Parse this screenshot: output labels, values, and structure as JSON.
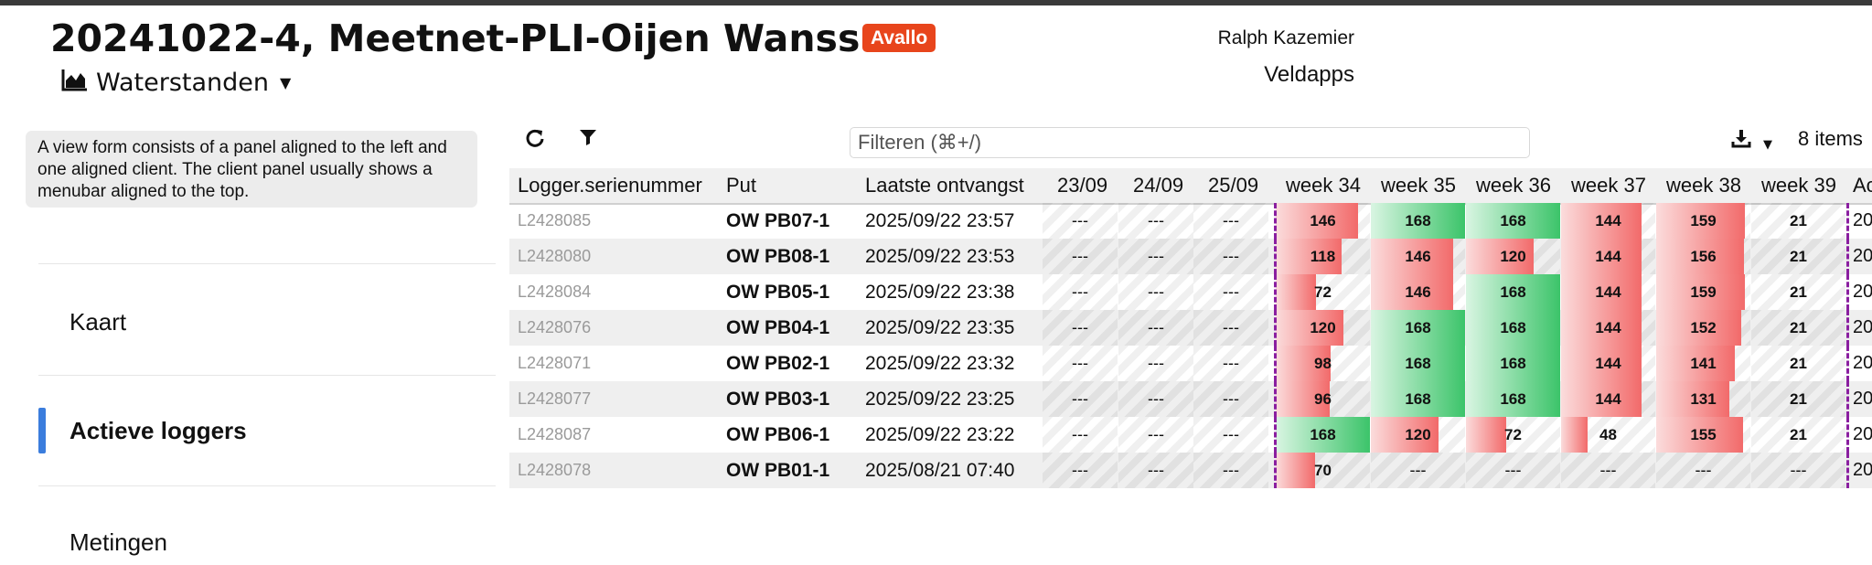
{
  "header": {
    "title": "20241022-4, Meetnet-PLI-Oijen Wanssum",
    "badge": "Avallo",
    "view_label": "Waterstanden",
    "user_name": "Ralph Kazemier",
    "app_name": "Veldapps"
  },
  "sidebar": {
    "info_text": "A view form consists of a panel aligned to the left and one aligned client. The client panel usually shows a menubar aligned to the top.",
    "items": [
      {
        "label": "Kaart",
        "active": false
      },
      {
        "label": "Actieve loggers",
        "active": true
      },
      {
        "label": "Metingen",
        "active": false
      }
    ]
  },
  "toolbar": {
    "filter_placeholder": "Filteren (⌘+/)",
    "items_count": "8 items"
  },
  "table": {
    "columns": [
      "Logger.serienummer",
      "Put",
      "Laatste ontvangst",
      "23/09",
      "24/09",
      "25/09",
      "week 34",
      "week 35",
      "week 36",
      "week 37",
      "week 38",
      "week 39",
      "Ac"
    ],
    "empty_value": "---",
    "max_per_week": 168,
    "rows": [
      {
        "serial": "L2428085",
        "put": "OW PB07-1",
        "last": "2025/09/22 23:57",
        "d1": "---",
        "d2": "---",
        "d3": "---",
        "w34": "146",
        "w35": "168",
        "w36": "168",
        "w37": "144",
        "w38": "159",
        "w39": "21",
        "extra": "20"
      },
      {
        "serial": "L2428080",
        "put": "OW PB08-1",
        "last": "2025/09/22 23:53",
        "d1": "---",
        "d2": "---",
        "d3": "---",
        "w34": "118",
        "w35": "146",
        "w36": "120",
        "w37": "144",
        "w38": "156",
        "w39": "21",
        "extra": "20"
      },
      {
        "serial": "L2428084",
        "put": "OW PB05-1",
        "last": "2025/09/22 23:38",
        "d1": "---",
        "d2": "---",
        "d3": "---",
        "w34": "72",
        "w35": "146",
        "w36": "168",
        "w37": "144",
        "w38": "159",
        "w39": "21",
        "extra": "20"
      },
      {
        "serial": "L2428076",
        "put": "OW PB04-1",
        "last": "2025/09/22 23:35",
        "d1": "---",
        "d2": "---",
        "d3": "---",
        "w34": "120",
        "w35": "168",
        "w36": "168",
        "w37": "144",
        "w38": "152",
        "w39": "21",
        "extra": "20"
      },
      {
        "serial": "L2428071",
        "put": "OW PB02-1",
        "last": "2025/09/22 23:32",
        "d1": "---",
        "d2": "---",
        "d3": "---",
        "w34": "98",
        "w35": "168",
        "w36": "168",
        "w37": "144",
        "w38": "141",
        "w39": "21",
        "extra": "20"
      },
      {
        "serial": "L2428077",
        "put": "OW PB03-1",
        "last": "2025/09/22 23:25",
        "d1": "---",
        "d2": "---",
        "d3": "---",
        "w34": "96",
        "w35": "168",
        "w36": "168",
        "w37": "144",
        "w38": "131",
        "w39": "21",
        "extra": "20"
      },
      {
        "serial": "L2428087",
        "put": "OW PB06-1",
        "last": "2025/09/22 23:22",
        "d1": "---",
        "d2": "---",
        "d3": "---",
        "w34": "168",
        "w35": "120",
        "w36": "72",
        "w37": "48",
        "w38": "155",
        "w39": "21",
        "extra": "20"
      },
      {
        "serial": "L2428078",
        "put": "OW PB01-1",
        "last": "2025/08/21 07:40",
        "d1": "---",
        "d2": "---",
        "d3": "---",
        "w34": "70",
        "w35": "---",
        "w36": "---",
        "w37": "---",
        "w38": "---",
        "w39": "---",
        "extra": "20"
      }
    ]
  },
  "colors": {
    "badge": "#e8451c",
    "active_bar": "#3b7ddd",
    "full_green": "#3cc46a",
    "partial_red": "#f26a6a",
    "marker": "#8a1fa0"
  },
  "icons": [
    "chart-area-icon",
    "caret-down-icon",
    "refresh-icon",
    "filter-icon",
    "download-icon"
  ]
}
